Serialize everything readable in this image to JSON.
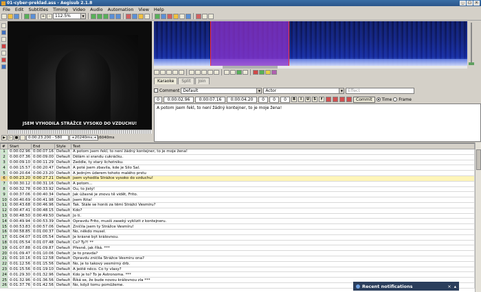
{
  "window": {
    "title": "01-cyber-preklad.ass - Aegisub 2.1.8"
  },
  "menu": [
    "File",
    "Edit",
    "Subtitles",
    "Timing",
    "Video",
    "Audio",
    "Automation",
    "View",
    "Help"
  ],
  "toolbar": {
    "zoom": "112.5%"
  },
  "video": {
    "subtitle": "JSEM VYHODILA STRÁŽCE VYSOKO DO VZDUCHU!",
    "position": "0:00:23.200 - 580",
    "offset1": "+20240ms;",
    "offset2": "+16040ms"
  },
  "tabs": [
    "Karaoke",
    "Split",
    "Join"
  ],
  "editbox": {
    "comment_label": "Comment",
    "style": "Default",
    "actor": "Actor",
    "effect_placeholder": "Effect",
    "layer": "0",
    "start": "0:00:02.96",
    "end": "0:00:07.16",
    "duration": "0:00:04.20",
    "margin_l": "0",
    "margin_r": "0",
    "margin_v": "0",
    "commit_label": "Commit",
    "time_label": "Time",
    "frame_label": "Frame",
    "text": "A potom jsem řekl, to není žádný kontejner, to je moje žena!"
  },
  "grid": {
    "headers": [
      "#",
      "Start",
      "End",
      "Style",
      "Text"
    ],
    "rows": [
      [
        "1",
        "0:00:02.96",
        "0:00:07.16",
        "Default",
        "A potom jsem řekl, to není žádný kontejner, to je moje žena!"
      ],
      [
        "2",
        "0:00:07.36",
        "0:00:09.00",
        "Default",
        "Dělám si srandu cukráčku."
      ],
      [
        "3",
        "0:00:09.10",
        "0:00:11.29",
        "Default",
        "Zeddle, ty starý lichotníku."
      ],
      [
        "4",
        "0:00:15.57",
        "0:00:20.47",
        "Default",
        "A poté jsem zbavila, kde je Silo Sal."
      ],
      [
        "5",
        "0:00:20.64",
        "0:00:23.20",
        "Default",
        "A jedným úderem tohoto malého prstu"
      ],
      [
        "6",
        "0:00:23.20",
        "0:00:27.21",
        "Default",
        "jsem vyhodila Strážce vysoko do vzduchu!"
      ],
      [
        "7",
        "0:00:30.12",
        "0:00:31.16",
        "Default",
        "A potom..."
      ],
      [
        "8",
        "0:00:32.78",
        "0:00:33.92",
        "Default",
        "Ou, to jistý!"
      ],
      [
        "9",
        "0:00:37.06",
        "0:00:40.34",
        "Default",
        "Jak úžasné je znovu tě vidět, Frito."
      ],
      [
        "10",
        "0:00:40.69",
        "0:00:41.98",
        "Default",
        "Jsem Rita!"
      ],
      [
        "11",
        "0:00:43.68",
        "0:00:46.96",
        "Default",
        "Tak. Stále se honíš za těmi Strážci Vesmíru?"
      ],
      [
        "12",
        "0:00:47.41",
        "0:00:48.15",
        "Default",
        "Kdo?"
      ],
      [
        "13",
        "0:00:48.50",
        "0:00:49.50",
        "Default",
        "Jo ti."
      ],
      [
        "14",
        "0:00:49.94",
        "0:00:53.39",
        "Default",
        "Opravdu Frito, musíš zaseký vyklizit z kontejneru."
      ],
      [
        "15",
        "0:00:53.83",
        "0:00:57.06",
        "Default",
        "Zničila jsem ty Strážce Vesmíru!"
      ],
      [
        "16",
        "0:00:58.85",
        "0:01:00.37",
        "Default",
        "No, někdo musel."
      ],
      [
        "17",
        "0:01:04.07",
        "0:01:05.54",
        "Default",
        "Je krásné být královnou."
      ],
      [
        "18",
        "0:01:05.54",
        "0:01:07.48",
        "Default",
        "Co? Ty?! **"
      ],
      [
        "19",
        "0:01:07.88",
        "0:01:09.87",
        "Default",
        "Přesně, jak říká. ***"
      ],
      [
        "20",
        "0:01:09.47",
        "0:01:10.06",
        "Default",
        "Je to pravda?"
      ],
      [
        "21",
        "0:01:10.16",
        "0:01:12.58",
        "Default",
        "Opravdu zničila Strážce Vesmíru ona?"
      ],
      [
        "22",
        "0:01:12.56",
        "0:01:15.56",
        "Default",
        "No, je to takový vesmírný drb."
      ],
      [
        "23",
        "0:01:15.56",
        "0:01:19.10",
        "Default",
        "A ještě něco. Co ty vlasy?"
      ],
      [
        "24",
        "0:01:29.30",
        "0:01:32.96",
        "Default",
        "Kdo je to? To je Astronoma. ***"
      ],
      [
        "25",
        "0:01:32.96",
        "0:01:36.56",
        "Default",
        "Říká se, že bude novou královnou zla ***"
      ],
      [
        "26",
        "0:01:37.76",
        "0:01:42.56",
        "Default",
        "No, když tomu pomůžeme."
      ]
    ]
  },
  "notification": {
    "title": "Recent notifications"
  }
}
